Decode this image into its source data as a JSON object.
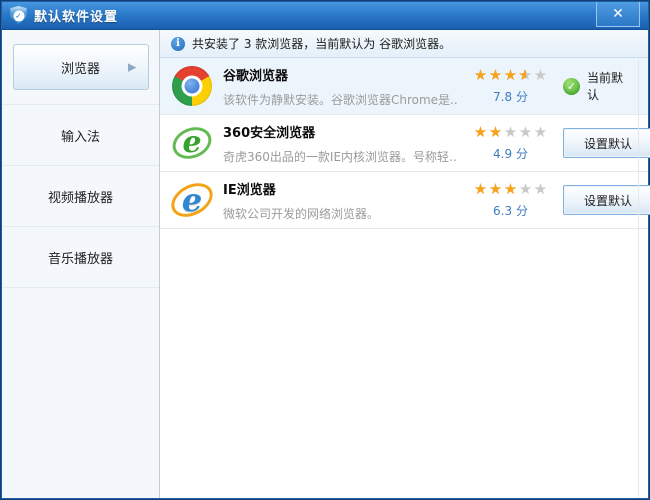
{
  "window": {
    "title": "默认软件设置",
    "close_label": "✕"
  },
  "sidebar": {
    "items": [
      {
        "label": "浏览器",
        "selected": true
      },
      {
        "label": "输入法",
        "selected": false
      },
      {
        "label": "视频播放器",
        "selected": false
      },
      {
        "label": "音乐播放器",
        "selected": false
      }
    ]
  },
  "info_bar": {
    "text": "共安装了 3 款浏览器，当前默认为 谷歌浏览器。"
  },
  "browsers": [
    {
      "name": "谷歌浏览器",
      "description": "该软件为静默安装。谷歌浏览器Chrome是...",
      "icon": "chrome-icon",
      "stars": 3.5,
      "score_label": "7.8 分",
      "status_label": "当前默认",
      "is_current_default": true
    },
    {
      "name": "360安全浏览器",
      "description": "奇虎360出品的一款IE内核浏览器。号称轻...",
      "icon": "360-browser-icon",
      "stars": 2,
      "score_label": "4.9 分",
      "action_label": "设置默认",
      "is_current_default": false
    },
    {
      "name": "IE浏览器",
      "description": "微软公司开发的网络浏览器。",
      "icon": "ie-browser-icon",
      "stars": 3,
      "score_label": "6.3 分",
      "action_label": "设置默认",
      "is_current_default": false
    }
  ],
  "icons": {
    "titlebar_shield_check": "✓",
    "info_i": "i",
    "selected_arrow": "▶",
    "current_default_check": "✓",
    "star": "★"
  },
  "colors": {
    "titlebar_blue": "#2b7ac9",
    "sidebar_bg": "#f4f8fc",
    "current_row_bg": "#edf5fc",
    "star_orange": "#f9a318",
    "star_gray": "#c9c9c9",
    "score_blue": "#3f7cc0",
    "success_green": "#49ad2b",
    "button_border_blue": "#7fb0df"
  }
}
